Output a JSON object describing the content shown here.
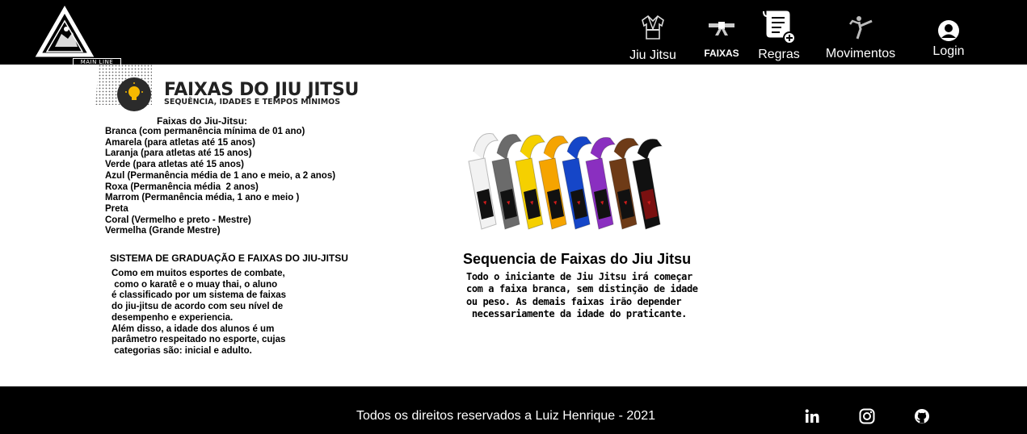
{
  "header": {
    "logo_text": "MAIN LINE",
    "nav": [
      {
        "label": "Jiu Jitsu",
        "icon": "kimono-icon"
      },
      {
        "label": "FAIXAS",
        "icon": "belt-icon"
      },
      {
        "label": "Regras",
        "icon": "rules-scroll-icon"
      },
      {
        "label": "Movimentos",
        "icon": "kick-icon"
      },
      {
        "label": "Login",
        "icon": "user-icon"
      }
    ]
  },
  "banner": {
    "title": "FAIXAS DO JIU JITSU",
    "subtitle": "SEQUÊNCIA, IDADES E TEMPOS MÍNIMOS",
    "icon": "lightbulb-icon"
  },
  "belts": {
    "heading": "Faixas do Jiu-Jitsu:",
    "items": [
      "Branca (com permanência mínima de 01 ano)",
      "Amarela (para atletas até 15 anos)",
      "Laranja (para atletas até 15 anos)",
      "Verde (para atletas até 15 anos)",
      "Azul (Permanência média de 1 ano e meio, a 2 anos)",
      "Roxa (Permanência média  2 anos)",
      "Marrom (Permanência média, 1 ano e meio )",
      "Preta",
      "Coral (Vermelho e preto - Mestre)",
      "Vermelha (Grande Mestre)"
    ]
  },
  "graduation": {
    "heading": "SISTEMA DE GRADUAÇÃO E FAIXAS DO JIU-JITSU",
    "text": "Como em muitos esportes de combate,\n como o karatê e o muay thai, o aluno\né classificado por um sistema de faixas\ndo jiu-jitsu de acordo com seu nível de\ndesempenho e experiencia.\nAlém disso, a idade dos alunos é um\nparâmetro respeitado no esporte, cujas\n categorias são: inicial e adulto."
  },
  "sequence": {
    "heading": "Sequencia de Faixas do Jiu Jitsu",
    "text": "Todo o iniciante de Jiu Jitsu irá começar\ncom a faixa branca, sem distinção de idade\nou peso. As demais faixas irão depender\n necessariamente da idade do praticante.",
    "belt_colors": [
      "#f2f2f2",
      "#6b6b6b",
      "#f5d000",
      "#f5a400",
      "#1546c8",
      "#8a2fc0",
      "#6e3b17",
      "#111111"
    ]
  },
  "footer": {
    "copyright": "Todos os direitos reservados a Luiz Henrique - 2021",
    "social": [
      {
        "name": "linkedin-icon"
      },
      {
        "name": "instagram-icon"
      },
      {
        "name": "github-icon"
      }
    ]
  }
}
